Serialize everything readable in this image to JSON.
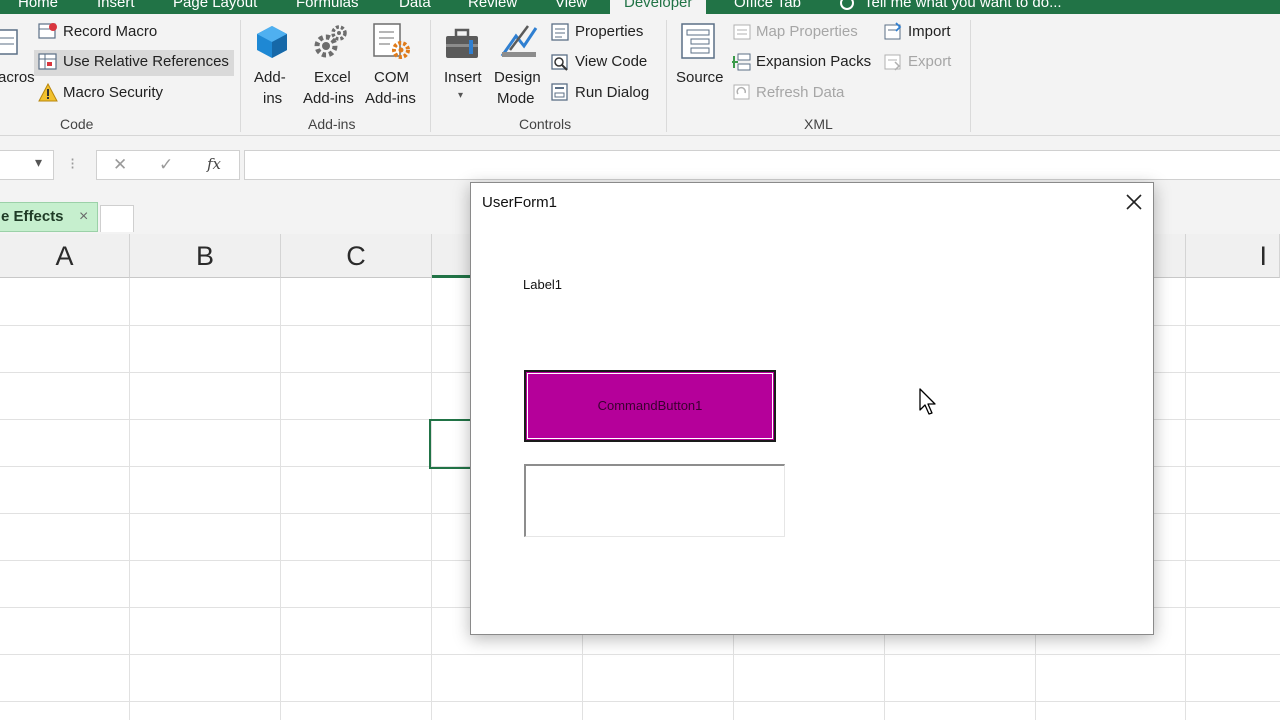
{
  "tabs": [
    "Home",
    "Insert",
    "Page Layout",
    "Formulas",
    "Data",
    "Review",
    "View",
    "Developer",
    "Office Tab",
    "Tell me what you want to do..."
  ],
  "ribbon": {
    "code": {
      "macros_partial": "acros",
      "record_macro": "Record Macro",
      "use_relative": "Use Relative References",
      "macro_security": "Macro Security",
      "group": "Code"
    },
    "addins": {
      "addins_1": "Add-",
      "addins_2": "ins",
      "excel_1": "Excel",
      "excel_2": "Add-ins",
      "com_1": "COM",
      "com_2": "Add-ins",
      "group": "Add-ins"
    },
    "controls": {
      "insert": "Insert",
      "design_1": "Design",
      "design_2": "Mode",
      "properties": "Properties",
      "view_code": "View Code",
      "run_dialog": "Run Dialog",
      "group": "Controls"
    },
    "xml": {
      "source": "Source",
      "map_properties": "Map Properties",
      "expansion_packs": "Expansion Packs",
      "refresh_data": "Refresh Data",
      "import": "Import",
      "export": "Export",
      "group": "XML"
    }
  },
  "formula_bar": {
    "cancel_glyph": "✕",
    "enter_glyph": "✓",
    "fx_glyph": "fx",
    "dropdown_glyph": "▾",
    "dots_glyph": "⁝"
  },
  "sheet_tab": {
    "label": "e Effects",
    "close_glyph": "×"
  },
  "columns": [
    "A",
    "B",
    "C",
    "I"
  ],
  "userform": {
    "title": "UserForm1",
    "label": "Label1",
    "button": "CommandButton1",
    "textbox_value": ""
  },
  "colors": {
    "accent": "#217346",
    "button": "#b5009a",
    "sheet_tab": "#c6efce"
  }
}
